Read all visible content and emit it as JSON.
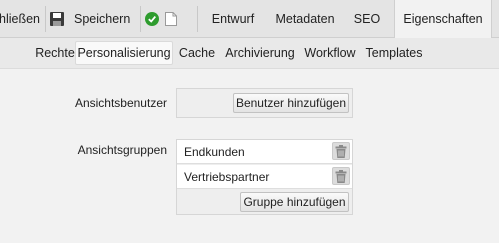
{
  "toolbar": {
    "close_label": "hließen",
    "save_label": "Speichern",
    "tabs": [
      "Entwurf",
      "Metadaten",
      "SEO",
      "Eigenschaften"
    ],
    "active_tab": "Eigenschaften"
  },
  "subtabs": {
    "items": [
      "Rechte",
      "Personalisierung",
      "Cache",
      "Archivierung",
      "Workflow",
      "Templates"
    ],
    "active": "Personalisierung"
  },
  "form": {
    "users": {
      "label": "Ansichtsbenutzer",
      "add_button": "Benutzer hinzufügen"
    },
    "groups": {
      "label": "Ansichtsgruppen",
      "items": [
        "Endkunden",
        "Vertriebspartner"
      ],
      "add_button": "Gruppe hinzufügen"
    }
  },
  "colors": {
    "status_ok": "#2e9c2e",
    "toolbar_bg": "#e4e4e4",
    "page_bg": "#f2f2f2"
  }
}
